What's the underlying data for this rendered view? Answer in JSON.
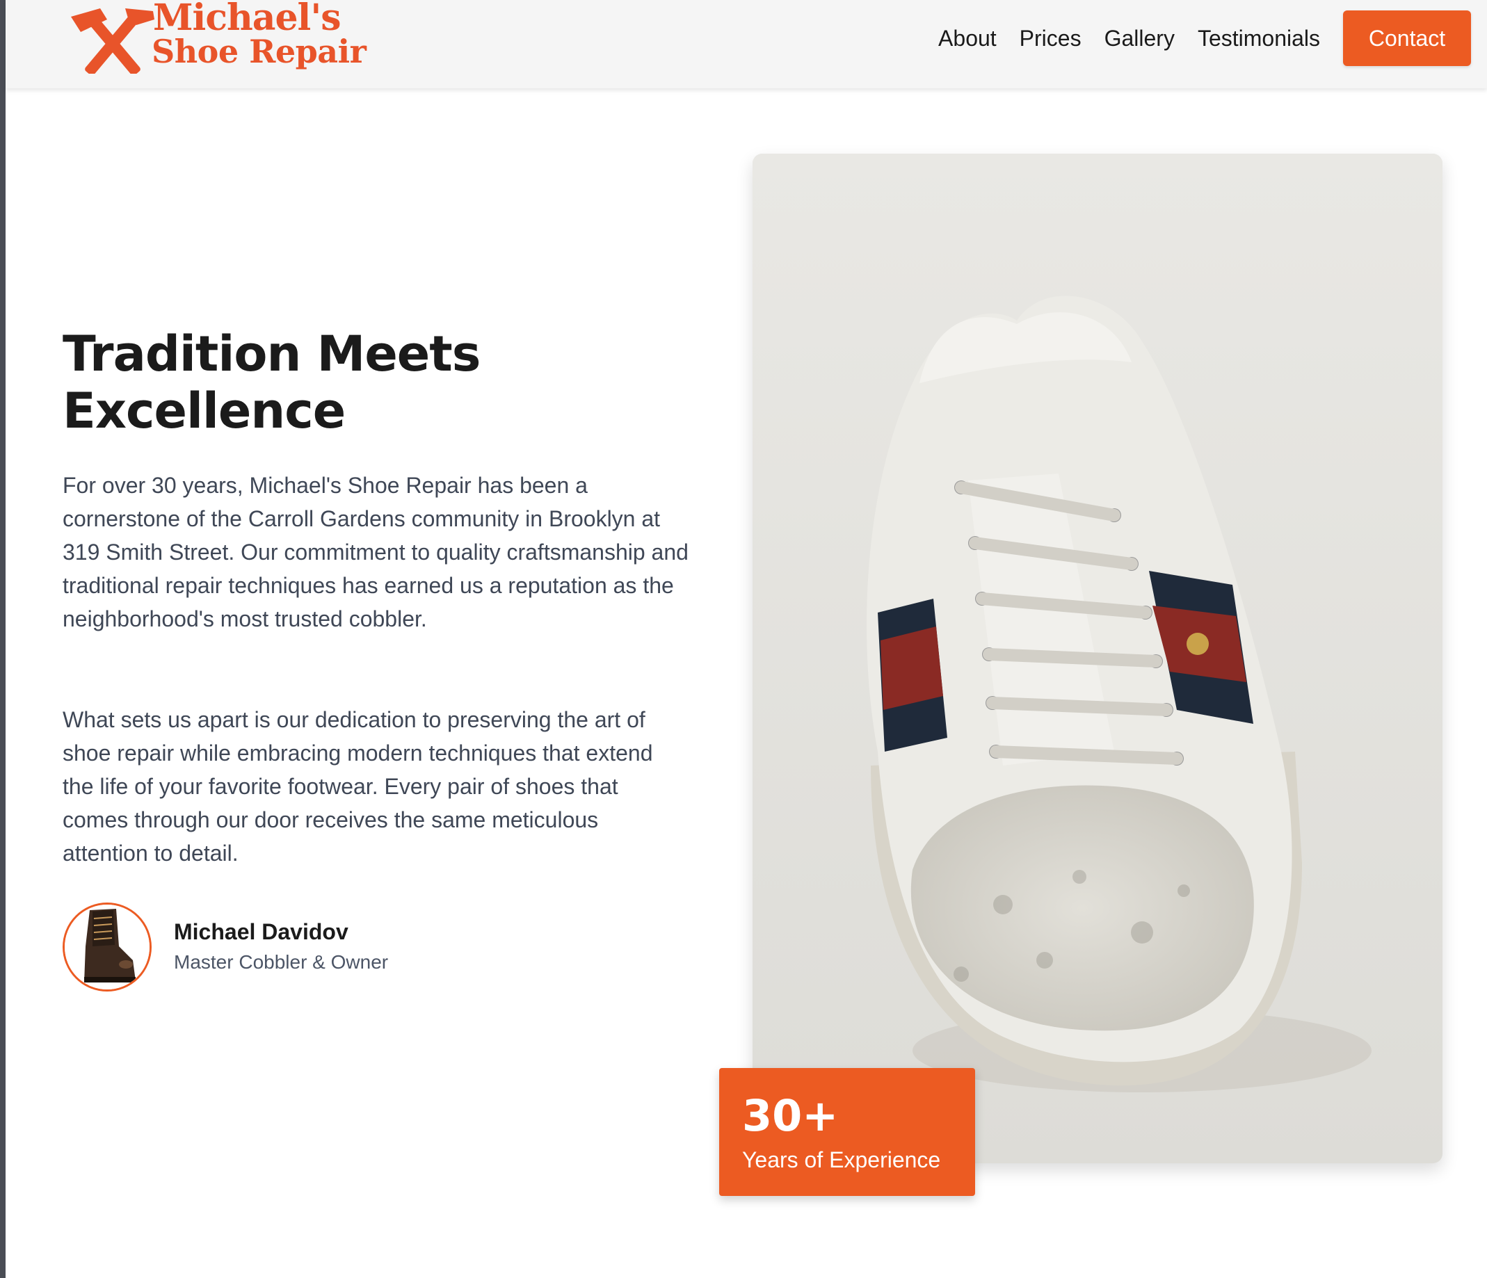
{
  "brand": {
    "name_line1": "Michael's",
    "name_line2": "Shoe Repair",
    "icon": "crossed-hammers-icon",
    "accent_color": "#ec5b22"
  },
  "nav": {
    "links": [
      "About",
      "Prices",
      "Gallery",
      "Testimonials"
    ],
    "contact_label": "Contact"
  },
  "about": {
    "headline_line1": "Tradition Meets",
    "headline_line2": "Excellence",
    "paragraph1": "For over 30 years, Michael's Shoe Repair has been a cornerstone of the Carroll Gardens community in Brooklyn at 319 Smith Street. Our commitment to quality craftsmanship and traditional repair techniques has earned us a reputation as the neighborhood's most trusted cobbler.",
    "paragraph2": "What sets us apart is our dedication to preserving the art of shoe repair while embracing modern techniques that extend the life of your favorite footwear. Every pair of shoes that comes through our door receives the same meticulous attention to detail."
  },
  "owner": {
    "name": "Michael Davidov",
    "role": "Master Cobbler & Owner",
    "avatar": "leather-boot-photo"
  },
  "experience": {
    "number": "30+",
    "label": "Years of Experience"
  },
  "photo": "worn-white-sneaker-photo"
}
